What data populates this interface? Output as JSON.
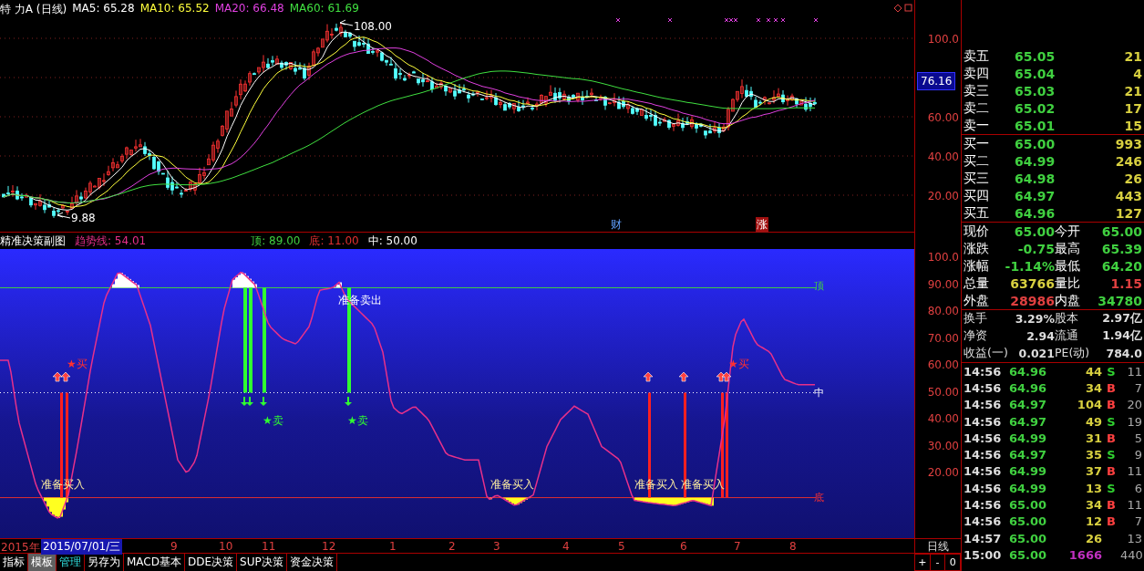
{
  "price_chart": {
    "title": "特 力A (日线)",
    "indicators": [
      {
        "label": "MA5: 65.28",
        "color": "#ffffff"
      },
      {
        "label": "MA10: 65.52",
        "color": "#ffff3c"
      },
      {
        "label": "MA20: 66.48",
        "color": "#e040e0"
      },
      {
        "label": "MA60: 61.69",
        "color": "#40e040"
      }
    ],
    "axis_labels": [
      {
        "text": "100.0",
        "highlighted": false
      },
      {
        "text": "76.16",
        "highlighted": true
      },
      {
        "text": "60.00",
        "highlighted": false
      },
      {
        "text": "40.00",
        "highlighted": false
      },
      {
        "text": "20.00",
        "highlighted": false
      }
    ],
    "high_label": "108.00",
    "low_label": "9.88",
    "event_marks": [
      {
        "text": "财",
        "kind": "finance"
      },
      {
        "text": "涨",
        "kind": "limit"
      }
    ]
  },
  "indicator_panel": {
    "title": "精准决策副图",
    "values": [
      {
        "label": "趋势线: 54.01",
        "color": "#e8308a"
      },
      {
        "label": "顶: 89.00",
        "color": "#40d040"
      },
      {
        "label": "底: 11.00",
        "color": "#e03030"
      },
      {
        "label": "中: 50.00",
        "color": "#ffffff"
      }
    ],
    "axis_labels": [
      "100.0",
      "90.00",
      "80.00",
      "70.00",
      "60.00",
      "50.00",
      "40.00",
      "30.00",
      "20.00"
    ],
    "line_labels": [
      {
        "text": "顶",
        "kind": "top"
      },
      {
        "text": "中",
        "kind": "middle"
      },
      {
        "text": "底",
        "kind": "bottom"
      }
    ],
    "signals": [
      {
        "text": "★买",
        "kind": "buy"
      },
      {
        "text": "准备卖出",
        "kind": "prepare_sell"
      },
      {
        "text": "★卖",
        "kind": "sell"
      },
      {
        "text": "★卖",
        "kind": "sell"
      },
      {
        "text": "★买",
        "kind": "buy"
      },
      {
        "text": "准备买入",
        "kind": "prepare_buy"
      },
      {
        "text": "准备买入",
        "kind": "prepare_buy"
      },
      {
        "text": "准备买入",
        "kind": "prepare_buy"
      },
      {
        "text": "准备买入",
        "kind": "prepare_buy"
      }
    ]
  },
  "date_axis": {
    "year": "2015年",
    "cursor_date": "2015/07/01/三",
    "months": [
      "9",
      "10",
      "11",
      "12",
      "1",
      "2",
      "3",
      "4",
      "5",
      "6",
      "7",
      "8"
    ]
  },
  "toolbar": [
    {
      "label": "指标",
      "selected": false,
      "highlighted": false
    },
    {
      "label": "模板",
      "selected": true,
      "highlighted": false
    },
    {
      "label": "管理",
      "selected": false,
      "highlighted": true
    },
    {
      "label": "另存为",
      "selected": false,
      "highlighted": false
    },
    {
      "label": "MACD基本",
      "selected": false,
      "highlighted": false
    },
    {
      "label": "DDE决策",
      "selected": false,
      "highlighted": false
    },
    {
      "label": "SUP决策",
      "selected": false,
      "highlighted": false
    },
    {
      "label": "资金决策",
      "selected": false,
      "highlighted": false
    }
  ],
  "period": {
    "label": "日线",
    "zoom_buttons": [
      "+",
      "-",
      "0"
    ]
  },
  "order_book": {
    "sells": [
      {
        "label": "卖五",
        "price": "65.05",
        "volume": "21"
      },
      {
        "label": "卖四",
        "price": "65.04",
        "volume": "4"
      },
      {
        "label": "卖三",
        "price": "65.03",
        "volume": "21"
      },
      {
        "label": "卖二",
        "price": "65.02",
        "volume": "17"
      },
      {
        "label": "卖一",
        "price": "65.01",
        "volume": "15"
      }
    ],
    "buys": [
      {
        "label": "买一",
        "price": "65.00",
        "volume": "993"
      },
      {
        "label": "买二",
        "price": "64.99",
        "volume": "246"
      },
      {
        "label": "买三",
        "price": "64.98",
        "volume": "26"
      },
      {
        "label": "买四",
        "price": "64.97",
        "volume": "443"
      },
      {
        "label": "买五",
        "price": "64.96",
        "volume": "127"
      }
    ]
  },
  "quote": [
    {
      "label": "现价",
      "value": "65.00",
      "color": "#40d040"
    },
    {
      "label": "今开",
      "value": "65.00",
      "color": "#40d040"
    },
    {
      "label": "涨跌",
      "value": "-0.75",
      "color": "#40d040"
    },
    {
      "label": "最高",
      "value": "65.39",
      "color": "#40d040"
    },
    {
      "label": "涨幅",
      "value": "-1.14%",
      "color": "#40d040"
    },
    {
      "label": "最低",
      "value": "64.20",
      "color": "#40d040"
    },
    {
      "label": "总量",
      "value": "63766",
      "color": "#d8d040"
    },
    {
      "label": "量比",
      "value": "1.15",
      "color": "#e04040"
    },
    {
      "label": "外盘",
      "value": "28986",
      "color": "#e04040"
    },
    {
      "label": "内盘",
      "value": "34780",
      "color": "#40d040"
    }
  ],
  "fundamentals": [
    {
      "label": "换手",
      "value": "3.29%"
    },
    {
      "label": "股本",
      "value": "2.97亿"
    },
    {
      "label": "净资",
      "value": "2.94"
    },
    {
      "label": "流通",
      "value": "1.94亿"
    },
    {
      "label": "收益(一)",
      "value": "0.021"
    },
    {
      "label": "PE(动)",
      "value": "784.0"
    }
  ],
  "ticks": [
    {
      "time": "14:56",
      "price": "64.96",
      "volume": "44",
      "side": "S",
      "count": "11",
      "kind": "sell"
    },
    {
      "time": "14:56",
      "price": "64.96",
      "volume": "34",
      "side": "B",
      "count": "7",
      "kind": "buy"
    },
    {
      "time": "14:56",
      "price": "64.97",
      "volume": "104",
      "side": "B",
      "count": "20",
      "kind": "buy"
    },
    {
      "time": "14:56",
      "price": "64.97",
      "volume": "49",
      "side": "S",
      "count": "19",
      "kind": "sell"
    },
    {
      "time": "14:56",
      "price": "64.99",
      "volume": "31",
      "side": "B",
      "count": "5",
      "kind": "buy"
    },
    {
      "time": "14:56",
      "price": "64.97",
      "volume": "35",
      "side": "S",
      "count": "9",
      "kind": "sell"
    },
    {
      "time": "14:56",
      "price": "64.99",
      "volume": "37",
      "side": "B",
      "count": "11",
      "kind": "buy"
    },
    {
      "time": "14:56",
      "price": "64.99",
      "volume": "13",
      "side": "S",
      "count": "6",
      "kind": "sell"
    },
    {
      "time": "14:56",
      "price": "65.00",
      "volume": "34",
      "side": "B",
      "count": "11",
      "kind": "buy"
    },
    {
      "time": "14:56",
      "price": "65.00",
      "volume": "12",
      "side": "B",
      "count": "7",
      "kind": "buy"
    },
    {
      "time": "14:57",
      "price": "65.00",
      "volume": "26",
      "count": "13",
      "kind": "neutral"
    },
    {
      "time": "15:00",
      "price": "65.00",
      "volume": "1666",
      "count": "440",
      "kind": "closing"
    }
  ]
}
